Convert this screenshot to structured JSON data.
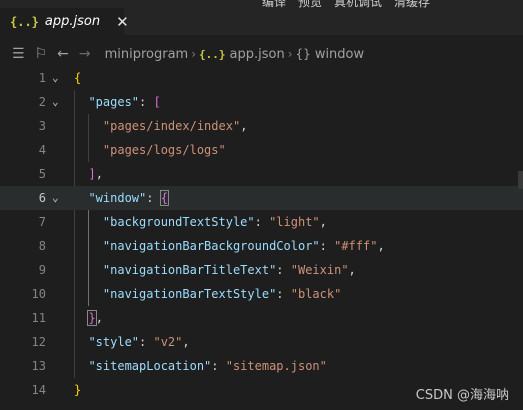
{
  "top_strip_text": [
    "编译",
    "预览",
    "真机调试",
    "清缓存"
  ],
  "tab": {
    "icon": "{..}",
    "label": "app.json",
    "close": "✕"
  },
  "breadcrumb": {
    "folder": "miniprogram",
    "file_icon": "{..}",
    "file": "app.json",
    "symbol_icon": "{}",
    "symbol": "window"
  },
  "editor": {
    "current_line": 6,
    "lines": [
      {
        "n": "1",
        "fold": "⌄",
        "tokens": [
          {
            "t": "{",
            "c": "tok-bracket1"
          }
        ]
      },
      {
        "n": "2",
        "fold": "⌄",
        "tokens": [
          {
            "t": "  ",
            "c": ""
          },
          {
            "t": "\"pages\"",
            "c": "tok-key"
          },
          {
            "t": ": ",
            "c": "tok-punc"
          },
          {
            "t": "[",
            "c": "tok-bracket2"
          }
        ]
      },
      {
        "n": "3",
        "fold": "",
        "tokens": [
          {
            "t": "    ",
            "c": ""
          },
          {
            "t": "\"pages/index/index\"",
            "c": "tok-str"
          },
          {
            "t": ",",
            "c": "tok-punc"
          }
        ]
      },
      {
        "n": "4",
        "fold": "",
        "tokens": [
          {
            "t": "    ",
            "c": ""
          },
          {
            "t": "\"pages/logs/logs\"",
            "c": "tok-str"
          }
        ]
      },
      {
        "n": "5",
        "fold": "",
        "tokens": [
          {
            "t": "  ",
            "c": ""
          },
          {
            "t": "]",
            "c": "tok-bracket2"
          },
          {
            "t": ",",
            "c": "tok-punc"
          }
        ]
      },
      {
        "n": "6",
        "fold": "⌄",
        "tokens": [
          {
            "t": "  ",
            "c": ""
          },
          {
            "t": "\"window\"",
            "c": "tok-key"
          },
          {
            "t": ": ",
            "c": "tok-punc"
          },
          {
            "t": "{",
            "c": "tok-bracket2 bracket-match"
          }
        ]
      },
      {
        "n": "7",
        "fold": "",
        "tokens": [
          {
            "t": "    ",
            "c": ""
          },
          {
            "t": "\"backgroundTextStyle\"",
            "c": "tok-key"
          },
          {
            "t": ": ",
            "c": "tok-punc"
          },
          {
            "t": "\"light\"",
            "c": "tok-str"
          },
          {
            "t": ",",
            "c": "tok-punc"
          }
        ]
      },
      {
        "n": "8",
        "fold": "",
        "tokens": [
          {
            "t": "    ",
            "c": ""
          },
          {
            "t": "\"navigationBarBackgroundColor\"",
            "c": "tok-key"
          },
          {
            "t": ": ",
            "c": "tok-punc"
          },
          {
            "t": "\"#fff\"",
            "c": "tok-str"
          },
          {
            "t": ",",
            "c": "tok-punc"
          }
        ]
      },
      {
        "n": "9",
        "fold": "",
        "tokens": [
          {
            "t": "    ",
            "c": ""
          },
          {
            "t": "\"navigationBarTitleText\"",
            "c": "tok-key"
          },
          {
            "t": ": ",
            "c": "tok-punc"
          },
          {
            "t": "\"Weixin\"",
            "c": "tok-str"
          },
          {
            "t": ",",
            "c": "tok-punc"
          }
        ]
      },
      {
        "n": "10",
        "fold": "",
        "tokens": [
          {
            "t": "    ",
            "c": ""
          },
          {
            "t": "\"navigationBarTextStyle\"",
            "c": "tok-key"
          },
          {
            "t": ": ",
            "c": "tok-punc"
          },
          {
            "t": "\"black\"",
            "c": "tok-str"
          }
        ]
      },
      {
        "n": "11",
        "fold": "",
        "tokens": [
          {
            "t": "  ",
            "c": ""
          },
          {
            "t": "}",
            "c": "tok-bracket2 bracket-match"
          },
          {
            "t": ",",
            "c": "tok-punc"
          }
        ]
      },
      {
        "n": "12",
        "fold": "",
        "tokens": [
          {
            "t": "  ",
            "c": ""
          },
          {
            "t": "\"style\"",
            "c": "tok-key"
          },
          {
            "t": ": ",
            "c": "tok-punc"
          },
          {
            "t": "\"v2\"",
            "c": "tok-str"
          },
          {
            "t": ",",
            "c": "tok-punc"
          }
        ]
      },
      {
        "n": "13",
        "fold": "",
        "tokens": [
          {
            "t": "  ",
            "c": ""
          },
          {
            "t": "\"sitemapLocation\"",
            "c": "tok-key"
          },
          {
            "t": ": ",
            "c": "tok-punc"
          },
          {
            "t": "\"sitemap.json\"",
            "c": "tok-str"
          }
        ]
      },
      {
        "n": "14",
        "fold": "",
        "tokens": [
          {
            "t": "}",
            "c": "tok-bracket1"
          }
        ]
      }
    ]
  },
  "watermark": "CSDN @海海呐",
  "colors": {
    "background": "#1e1e1e",
    "key": "#9cdcfe",
    "string": "#ce9178",
    "bracket_level1": "#ffd700",
    "bracket_level2": "#da70d6",
    "json_icon": "#cbcb41"
  }
}
